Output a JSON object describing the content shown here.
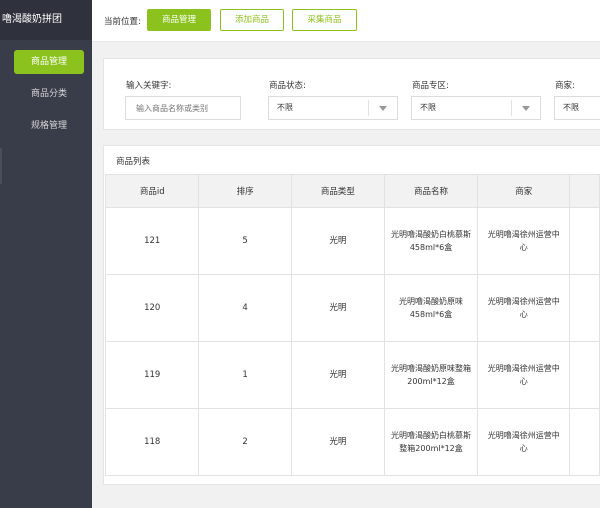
{
  "app": {
    "title": "嚕渴酸奶拼团"
  },
  "sidebar": {
    "items": [
      {
        "label": "商品管理",
        "active": true
      },
      {
        "label": "商品分类",
        "active": false
      },
      {
        "label": "规格管理",
        "active": false
      }
    ]
  },
  "header": {
    "breadcrumb_label": "当前位置:",
    "tabs": [
      {
        "label": "商品管理",
        "active": true
      },
      {
        "label": "添加商品",
        "active": false
      },
      {
        "label": "采集商品",
        "active": false
      }
    ]
  },
  "filters": {
    "keyword": {
      "label": "输入关键字:",
      "placeholder": "输入商品名称或类别"
    },
    "status": {
      "label": "商品状态:",
      "value": "不限"
    },
    "zone": {
      "label": "商品专区:",
      "value": "不限"
    },
    "merchant": {
      "label": "商家:",
      "value": "不限"
    }
  },
  "list": {
    "title": "商品列表",
    "columns": [
      "商品id",
      "排序",
      "商品类型",
      "商品名称",
      "商家",
      ""
    ],
    "rows": [
      {
        "id": "121",
        "sort": "5",
        "type": "光明",
        "name": "光明噜渴酸奶白桃慕斯458ml*6盒",
        "merchant": "光明噜渴徐州运营中心"
      },
      {
        "id": "120",
        "sort": "4",
        "type": "光明",
        "name": "光明噜渴酸奶原味458ml*6盒",
        "merchant": "光明噜渴徐州运营中心"
      },
      {
        "id": "119",
        "sort": "1",
        "type": "光明",
        "name": "光明噜渴酸奶原味整箱200ml*12盒",
        "merchant": "光明噜渴徐州运营中心"
      },
      {
        "id": "118",
        "sort": "2",
        "type": "光明",
        "name": "光明噜渴酸奶白桃慕斯整箱200ml*12盒",
        "merchant": "光明噜渴徐州运营中心"
      }
    ]
  },
  "colors": {
    "accent": "#8cc21d",
    "sidebar_bg": "#393d49",
    "brand_bg": "#2f323c"
  }
}
